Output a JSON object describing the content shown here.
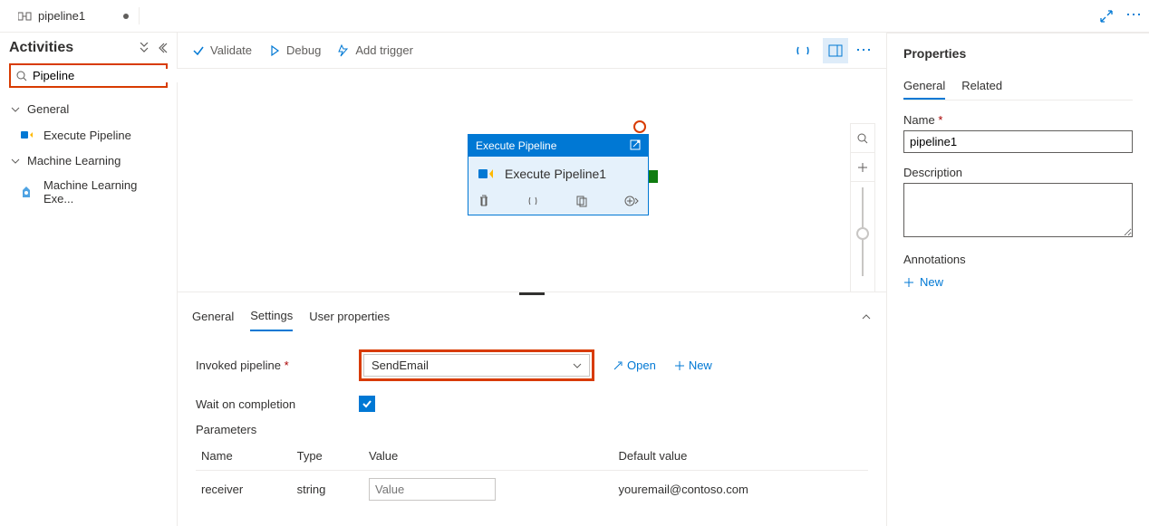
{
  "topbar": {
    "tab_title": "pipeline1"
  },
  "toolbar": {
    "validate": "Validate",
    "debug": "Debug",
    "add_trigger": "Add trigger"
  },
  "activities": {
    "title": "Activities",
    "search_value": "Pipeline",
    "groups": [
      {
        "name": "General",
        "items": [
          {
            "label": "Execute Pipeline"
          }
        ]
      },
      {
        "name": "Machine Learning",
        "items": [
          {
            "label": "Machine Learning Exe..."
          }
        ]
      }
    ]
  },
  "canvas": {
    "node_type": "Execute Pipeline",
    "node_title": "Execute Pipeline1"
  },
  "lower_pane": {
    "tabs": [
      "General",
      "Settings",
      "User properties"
    ],
    "active_tab": "Settings",
    "invoked_label": "Invoked pipeline",
    "invoked_value": "SendEmail",
    "open_label": "Open",
    "new_label": "New",
    "wait_label": "Wait on completion",
    "parameters_label": "Parameters",
    "columns": {
      "name": "Name",
      "type": "Type",
      "value": "Value",
      "default": "Default value"
    },
    "rows": [
      {
        "name": "receiver",
        "type": "string",
        "value_placeholder": "Value",
        "default": "youremail@contoso.com"
      }
    ]
  },
  "properties": {
    "title": "Properties",
    "tabs": [
      "General",
      "Related"
    ],
    "name_label": "Name",
    "name_value": "pipeline1",
    "description_label": "Description",
    "annotations_label": "Annotations",
    "new_label": "New"
  }
}
